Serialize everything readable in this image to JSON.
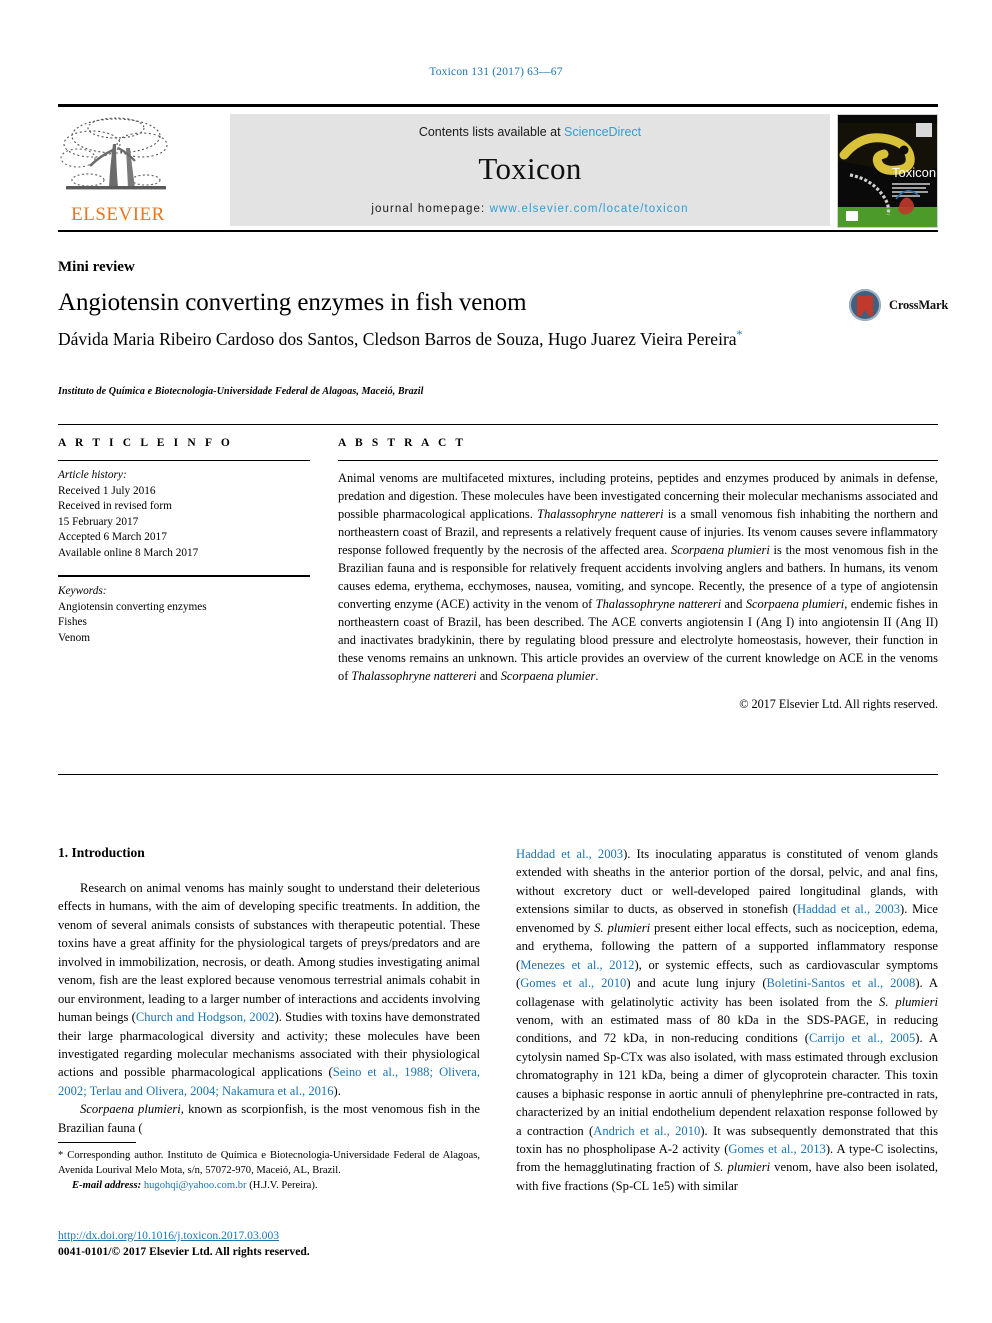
{
  "running_head": "Toxicon 131 (2017) 63—67",
  "banner": {
    "publisher": "ELSEVIER",
    "contents_prefix": "Contents lists available at ",
    "contents_link": "ScienceDirect",
    "journal_name": "Toxicon",
    "homepage_prefix": "journal homepage: ",
    "homepage_url": "www.elsevier.com/locate/toxicon",
    "cover_title": "Toxicon"
  },
  "article": {
    "type_label": "Mini review",
    "title": "Angiotensin converting enzymes in fish venom",
    "authors": "Dávida Maria Ribeiro Cardoso dos Santos, Cledson Barros de Souza, Hugo Juarez Vieira Pereira",
    "corresponding_marker": "*",
    "affiliation": "Instituto de Química e Biotecnologia-Universidade Federal de Alagoas, Maceió, Brazil",
    "crossmark_label": "CrossMark"
  },
  "info": {
    "heading": "A R T I C L E   I N F O",
    "history_label": "Article history:",
    "history_lines": [
      "Received 1 July 2016",
      "Received in revised form",
      "15 February 2017",
      "Accepted 6 March 2017",
      "Available online 8 March 2017"
    ],
    "keywords_label": "Keywords:",
    "keywords": [
      "Angiotensin converting enzymes",
      "Fishes",
      "Venom"
    ]
  },
  "abstract": {
    "heading": "A B S T R A C T",
    "text_part_1": "Animal venoms are multifaceted mixtures, including proteins, peptides and enzymes produced by animals in defense, predation and digestion. These molecules have been investigated concerning their molecular mechanisms associated and possible pharmacological applications. ",
    "species_1": "Thalassophryne nattereri",
    "text_part_2": " is a small venomous fish inhabiting the northern and northeastern coast of Brazil, and represents a relatively frequent cause of injuries. Its venom causes severe inflammatory response followed frequently by the necrosis of the affected area. ",
    "species_2": "Scorpaena plumieri",
    "text_part_3": " is the most venomous fish in the Brazilian fauna and is responsible for relatively frequent accidents involving anglers and bathers. In humans, its venom causes edema, erythema, ecchymoses, nausea, vomiting, and syncope. Recently, the presence of a type of angiotensin converting enzyme (ACE) activity in the venom of ",
    "species_3": "Thalassophryne nattereri",
    "text_part_4": " and ",
    "species_4": "Scorpaena plumieri",
    "text_part_5": ", endemic fishes in northeastern coast of Brazil, has been described. The ACE converts angiotensin I (Ang I) into angiotensin II (Ang II) and inactivates bradykinin, there by regulating blood pressure and electrolyte homeostasis, however, their function in these venoms remains an unknown. This article provides an overview of the current knowledge on ACE in the venoms of ",
    "species_5": "Thalassophryne nattereri",
    "text_part_6": " and ",
    "species_6": "Scorpaena plumier",
    "text_part_7": ".",
    "copyright": "© 2017 Elsevier Ltd. All rights reserved."
  },
  "introduction": {
    "heading": "1. Introduction",
    "p1_a": "Research on animal venoms has mainly sought to understand their deleterious effects in humans, with the aim of developing specific treatments. In addition, the venom of several animals consists of substances with therapeutic potential. These toxins have a great affinity for the physiological targets of preys/predators and are involved in immobilization, necrosis, or death. Among studies investigating animal venom, fish are the least explored because venomous terrestrial animals cohabit in our environment, leading to a larger number of interactions and accidents involving human beings (",
    "p1_ref1": "Church and Hodgson, 2002",
    "p1_b": "). Studies with toxins have demonstrated their large pharmacological diversity and activity; these molecules have been investigated regarding molecular mechanisms associated with their physiological actions and possible pharmacological applications (",
    "p1_ref2": "Seino et al., 1988; Olivera, 2002; Terlau and Olivera, 2004; Nakamura et al., 2016",
    "p1_c": ").",
    "p2_species": "Scorpaena plumieri",
    "p2_a": ", known as scorpionfish, is the most venomous fish in the Brazilian fauna (",
    "p2_ref1": "Haddad et al., 2003",
    "p2_b": "). Its inoculating apparatus is constituted of venom glands extended with sheaths in the anterior portion of the dorsal, pelvic, and anal fins, without excretory duct or well-developed paired longitudinal glands, with extensions similar to ducts, as observed in stonefish (",
    "p2_ref2": "Haddad et al., 2003",
    "p2_c": "). Mice envenomed by ",
    "p2_species2": "S. plumieri",
    "p2_d": " present either local effects, such as nociception, edema, and erythema, following the pattern of a supported inflammatory response (",
    "p2_ref3": "Menezes et al., 2012",
    "p2_e": "), or systemic effects, such as cardiovascular symptoms (",
    "p2_ref4": "Gomes et al., 2010",
    "p2_f": ") and acute lung injury (",
    "p2_ref5": "Boletini-Santos et al., 2008",
    "p2_g": "). A collagenase with gelatinolytic activity has been isolated from the ",
    "p2_species3": "S. plumieri",
    "p2_h": " venom, with an estimated mass of 80 kDa in the SDS-PAGE, in reducing conditions, and 72 kDa, in non-reducing conditions (",
    "p2_ref6": "Carrijo et al., 2005",
    "p2_i": "). A cytolysin named Sp-CTx was also isolated, with mass estimated through exclusion chromatography in 121 kDa, being a dimer of glycoprotein character. This toxin causes a biphasic response in aortic annuli of phenylephrine pre-contracted in rats, characterized by an initial endothelium dependent relaxation response followed by a contraction (",
    "p2_ref7": "Andrich et al., 2010",
    "p2_j": "). It was subsequently demonstrated that this toxin has no phospholipase A-2 activity (",
    "p2_ref8": "Gomes et al., 2013",
    "p2_k": "). A type-C isolectins, from the hemagglutinating fraction of ",
    "p2_species4": "S. plumieri",
    "p2_l": " venom, have also been isolated, with five fractions (Sp-CL 1e5) with similar"
  },
  "footer": {
    "corr_marker": "*",
    "corr_text": " Corresponding author. Instituto de Química e Biotecnologia-Universidade Federal de Alagoas, Avenida Lourival Melo Mota, s/n, 57072-970, Maceió, AL, Brazil.",
    "email_label": "E-mail address:",
    "email": "hugohqi@yahoo.com.br",
    "email_suffix": " (H.J.V. Pereira).",
    "doi": "http://dx.doi.org/10.1016/j.toxicon.2017.03.003",
    "issn": "0041-0101/© 2017 Elsevier Ltd. All rights reserved."
  },
  "colors": {
    "link": "#1b74b4",
    "sciencedirect": "#2e9fd4",
    "elsevier_orange": "#e87722",
    "banner_grey": "#e3e3e3"
  }
}
